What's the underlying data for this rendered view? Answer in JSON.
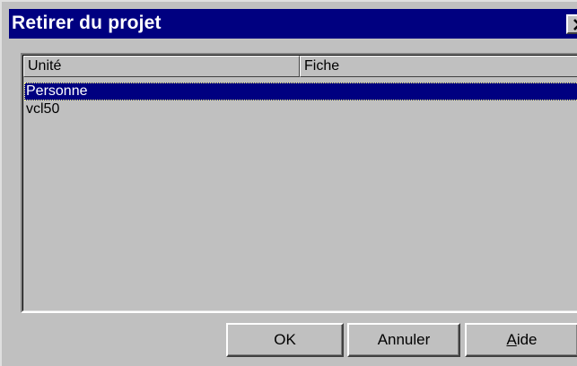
{
  "window": {
    "title": "Retirer du projet",
    "close_glyph": "×",
    "colors": {
      "titlebar": "#000080",
      "face": "#c0c0c0",
      "selection": "#000080"
    }
  },
  "list": {
    "columns": [
      {
        "label": "Unité"
      },
      {
        "label": "Fiche"
      }
    ],
    "rows": [
      {
        "unite": "Personne",
        "fiche": "",
        "selected": true
      },
      {
        "unite": "vcl50",
        "fiche": "",
        "selected": false
      }
    ]
  },
  "buttons": {
    "ok_label": "OK",
    "cancel_label": "Annuler",
    "help_label": "Aide"
  }
}
